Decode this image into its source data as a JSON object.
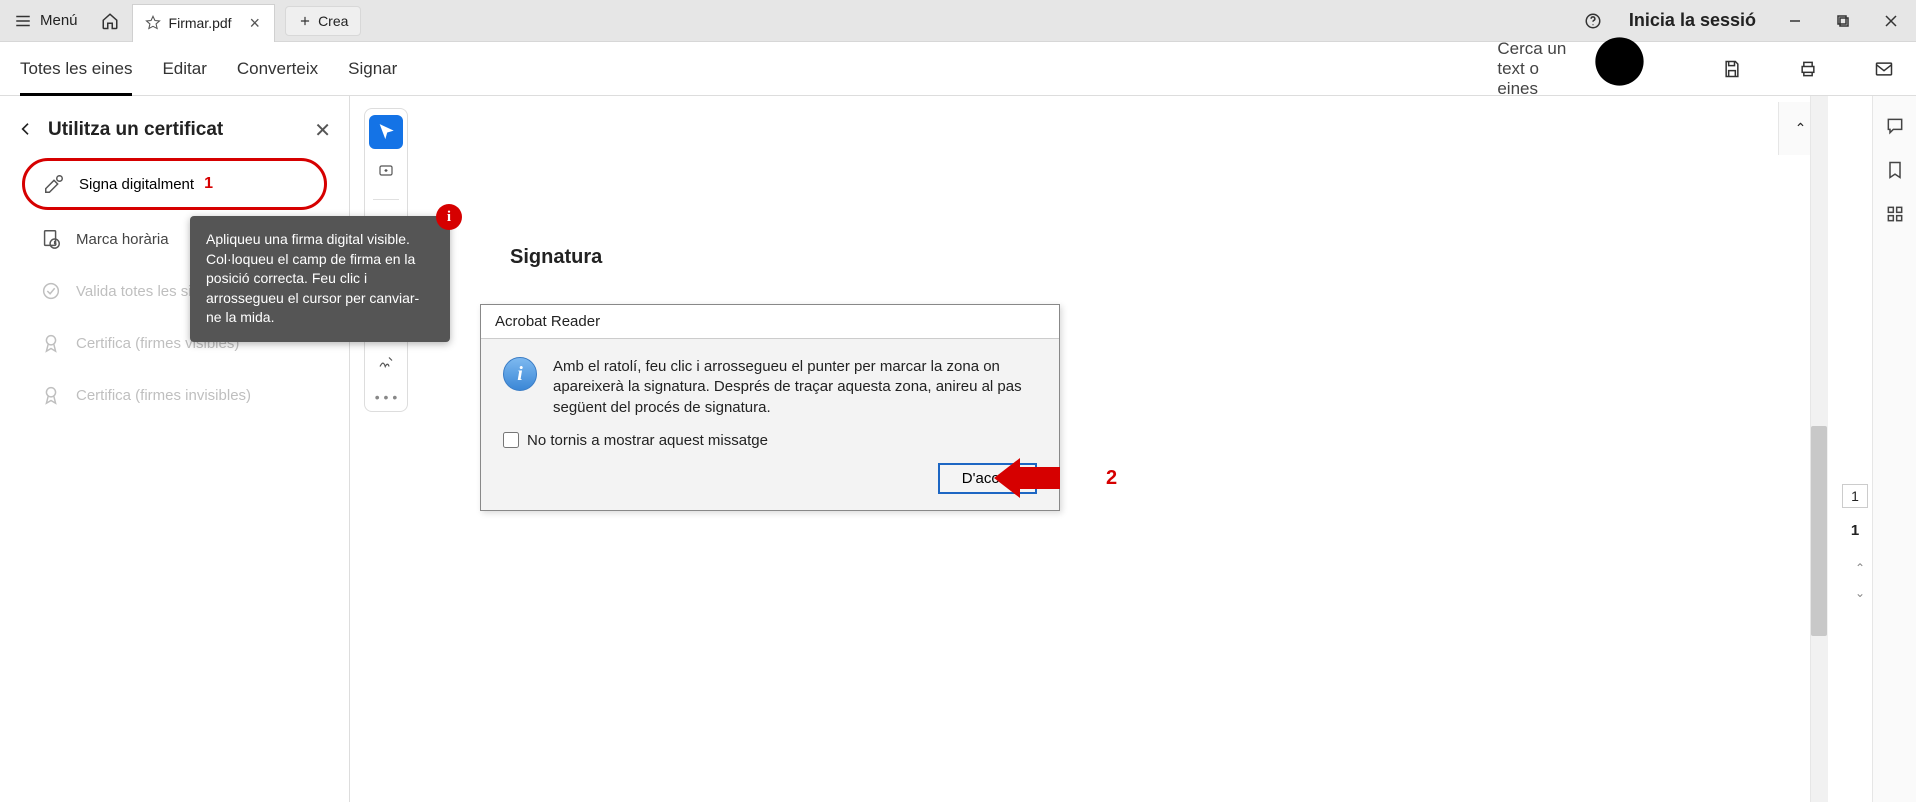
{
  "titlebar": {
    "menu_label": "Menú",
    "tab_name": "Firmar.pdf",
    "create_label": "Crea",
    "signin_label": "Inicia la sessió"
  },
  "toolbar": {
    "tabs": {
      "all_tools": "Totes les eines",
      "edit": "Editar",
      "convert": "Converteix",
      "sign": "Signar"
    },
    "search_placeholder": "Cerca un text o eines"
  },
  "side": {
    "title": "Utilitza un certificat",
    "items": {
      "sign_digitally": "Signa digitalment",
      "timestamp": "Marca horària",
      "validate_all": "Valida totes les signatures",
      "certify_visible": "Certifica (firmes visibles)",
      "certify_invisible": "Certifica (firmes invisibles)"
    },
    "tooltip": "Apliqueu una firma digital visible. Col·loqueu el camp de firma en la posició correcta. Feu clic i arrossegueu el cursor per canviar-ne la mida."
  },
  "document": {
    "heading": "Signatura"
  },
  "dialog": {
    "title": "Acrobat Reader",
    "body": "Amb el ratolí, feu clic i arrossegueu el punter per marcar la zona on apareixerà la signatura. Després de traçar aquesta zona, anireu al pas següent del procés de signatura.",
    "checkbox_label": "No tornis a mostrar aquest missatge",
    "ok_label": "D'acord"
  },
  "annotations": {
    "num1": "1",
    "num2": "2"
  },
  "page": {
    "current": "1",
    "total": "1"
  }
}
